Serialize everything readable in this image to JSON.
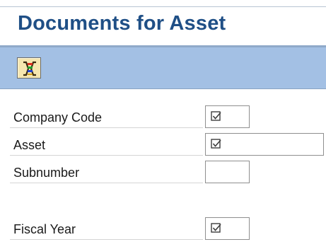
{
  "header": {
    "title": "Documents for Asset"
  },
  "toolbar": {
    "execute_icon": "multiple-selection-icon"
  },
  "form": {
    "fields": [
      {
        "label": "Company Code",
        "required": true
      },
      {
        "label": "Asset",
        "required": true
      },
      {
        "label": "Subnumber",
        "required": false
      },
      {
        "label": "Fiscal Year",
        "required": true
      }
    ]
  },
  "colors": {
    "title": "#1f4f86",
    "toolbar_bg": "#a3c0e4",
    "button_bg": "#f5e6b0"
  }
}
